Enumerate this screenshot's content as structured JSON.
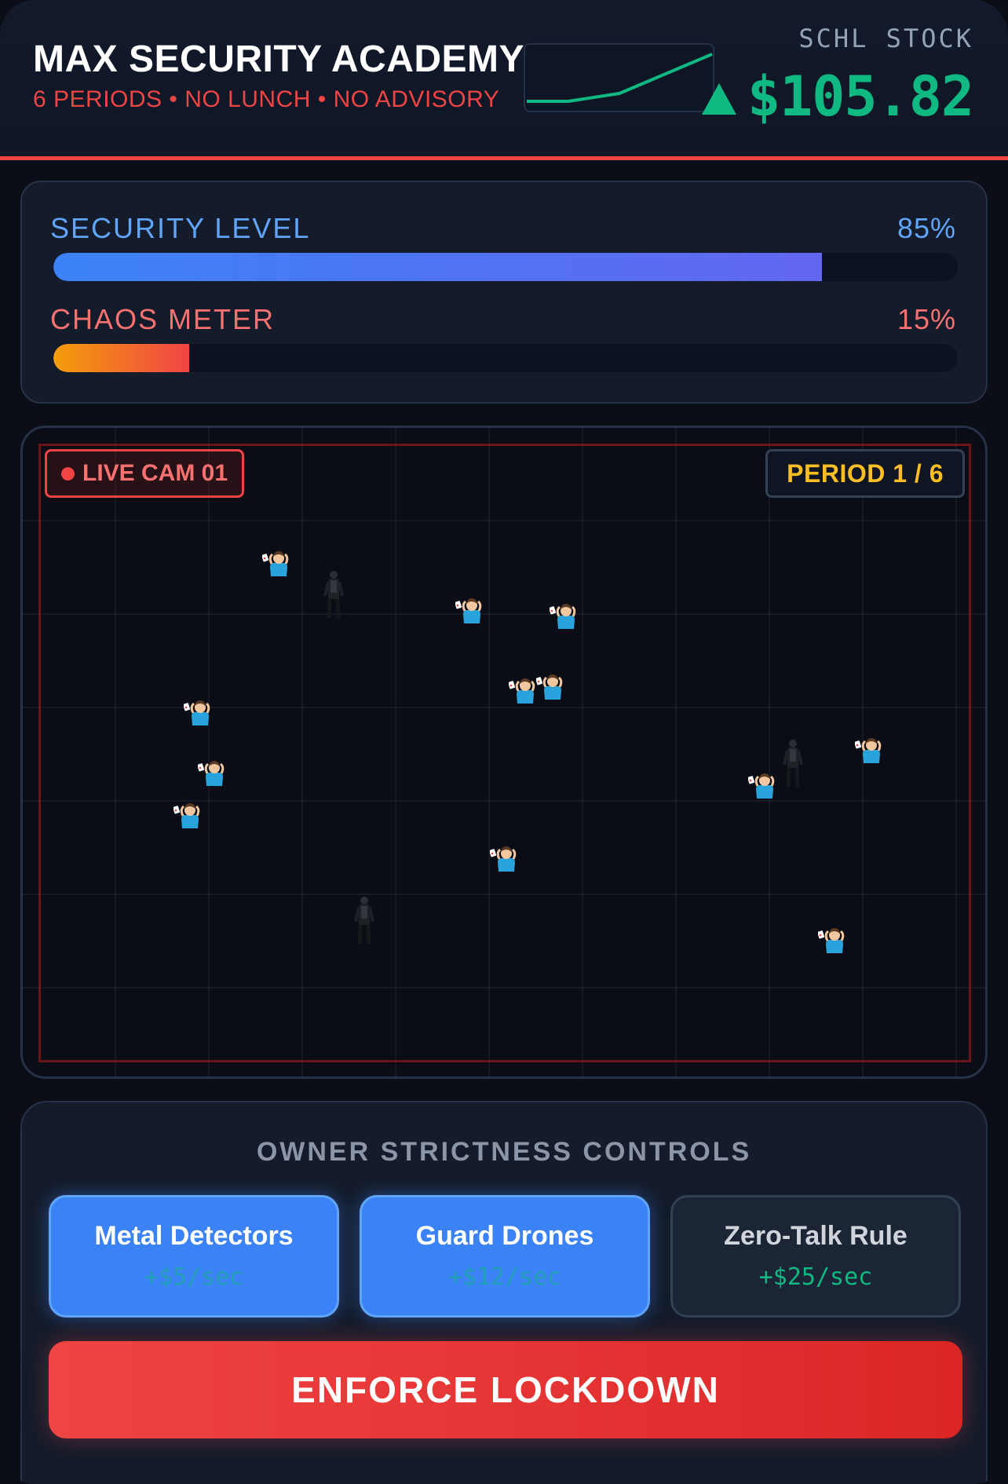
{
  "header": {
    "title": "MAX SECURITY ACADEMY",
    "subtitle": "6 PERIODS • NO LUNCH • NO ADVISORY",
    "stock_label": "SCHL STOCK",
    "stock_price": "$105.82",
    "stock_trend_icon": "triangle-up-icon",
    "trend_color": "#10b981"
  },
  "meters": {
    "security": {
      "label": "SECURITY LEVEL",
      "value_text": "85%",
      "value": 0.85,
      "color": "#3b82f6"
    },
    "chaos": {
      "label": "CHAOS METER",
      "value_text": "15%",
      "value": 0.15,
      "color": "#ef4444"
    }
  },
  "camera": {
    "live_label": "LIVE CAM 01",
    "period_label": "PERIOD 1 / 6"
  },
  "controls": {
    "title": "OWNER STRICTNESS CONTROLS",
    "buttons": [
      {
        "name": "Metal Detectors",
        "rate": "+$5/sec",
        "active": true
      },
      {
        "name": "Guard Drones",
        "rate": "+$12/sec",
        "active": true
      },
      {
        "name": "Zero-Talk Rule",
        "rate": "+$25/sec",
        "active": false
      }
    ],
    "lockdown_label": "ENFORCE LOCKDOWN"
  },
  "colors": {
    "accent_red": "#ef4444",
    "accent_blue": "#3b82f6",
    "accent_green": "#10b981",
    "accent_yellow": "#fbbf24"
  }
}
